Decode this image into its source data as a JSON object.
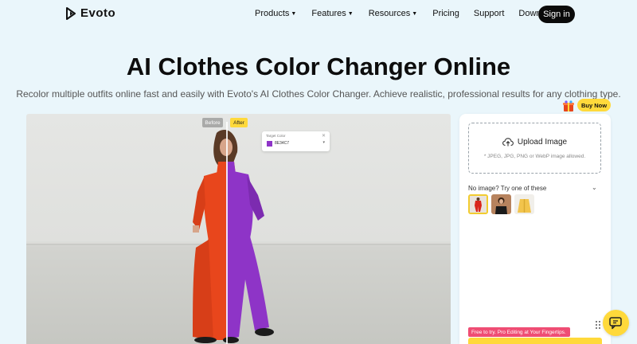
{
  "nav": {
    "logo_text": "Evoto",
    "items": [
      {
        "label": "Products",
        "dropdown": true
      },
      {
        "label": "Features",
        "dropdown": true
      },
      {
        "label": "Resources",
        "dropdown": true
      },
      {
        "label": "Pricing",
        "dropdown": false
      },
      {
        "label": "Support",
        "dropdown": false
      },
      {
        "label": "Download",
        "dropdown": false
      }
    ],
    "signin_label": "Sign in"
  },
  "hero": {
    "title": "AI Clothes Color Changer Online",
    "subtitle": "Recolor multiple outfits online fast and easily with Evoto's AI Clothes Color Changer. Achieve realistic, professional results for any clothing type.",
    "buy_now_label": "Buy Now"
  },
  "demo": {
    "before_label": "Before",
    "after_label": "After",
    "target_color_label": "Target Color",
    "target_color_value": "8E34C7",
    "before_color": "#e8461c",
    "after_color": "#8e34c7"
  },
  "upload": {
    "button_label": "Upload Image",
    "hint": "* JPEG, JPG, PNG or WebP image allowed.",
    "samples_label": "No image? Try one of these",
    "samples": [
      "sample-red-outfit",
      "sample-black-top",
      "sample-yellow-jacket"
    ],
    "promo": "Free to try. Pro Editing at Your Fingertips."
  },
  "colors": {
    "background": "#eaf6fb",
    "accent_yellow": "#ffd93b",
    "promo_pink": "#ef4d74",
    "dark": "#0b0b0b"
  },
  "icons": [
    "evoto-logo-icon",
    "caret-down-icon",
    "gift-icon",
    "cloud-upload-icon",
    "chevron-down-icon",
    "close-icon",
    "drag-grip-icon",
    "chat-icon"
  ]
}
